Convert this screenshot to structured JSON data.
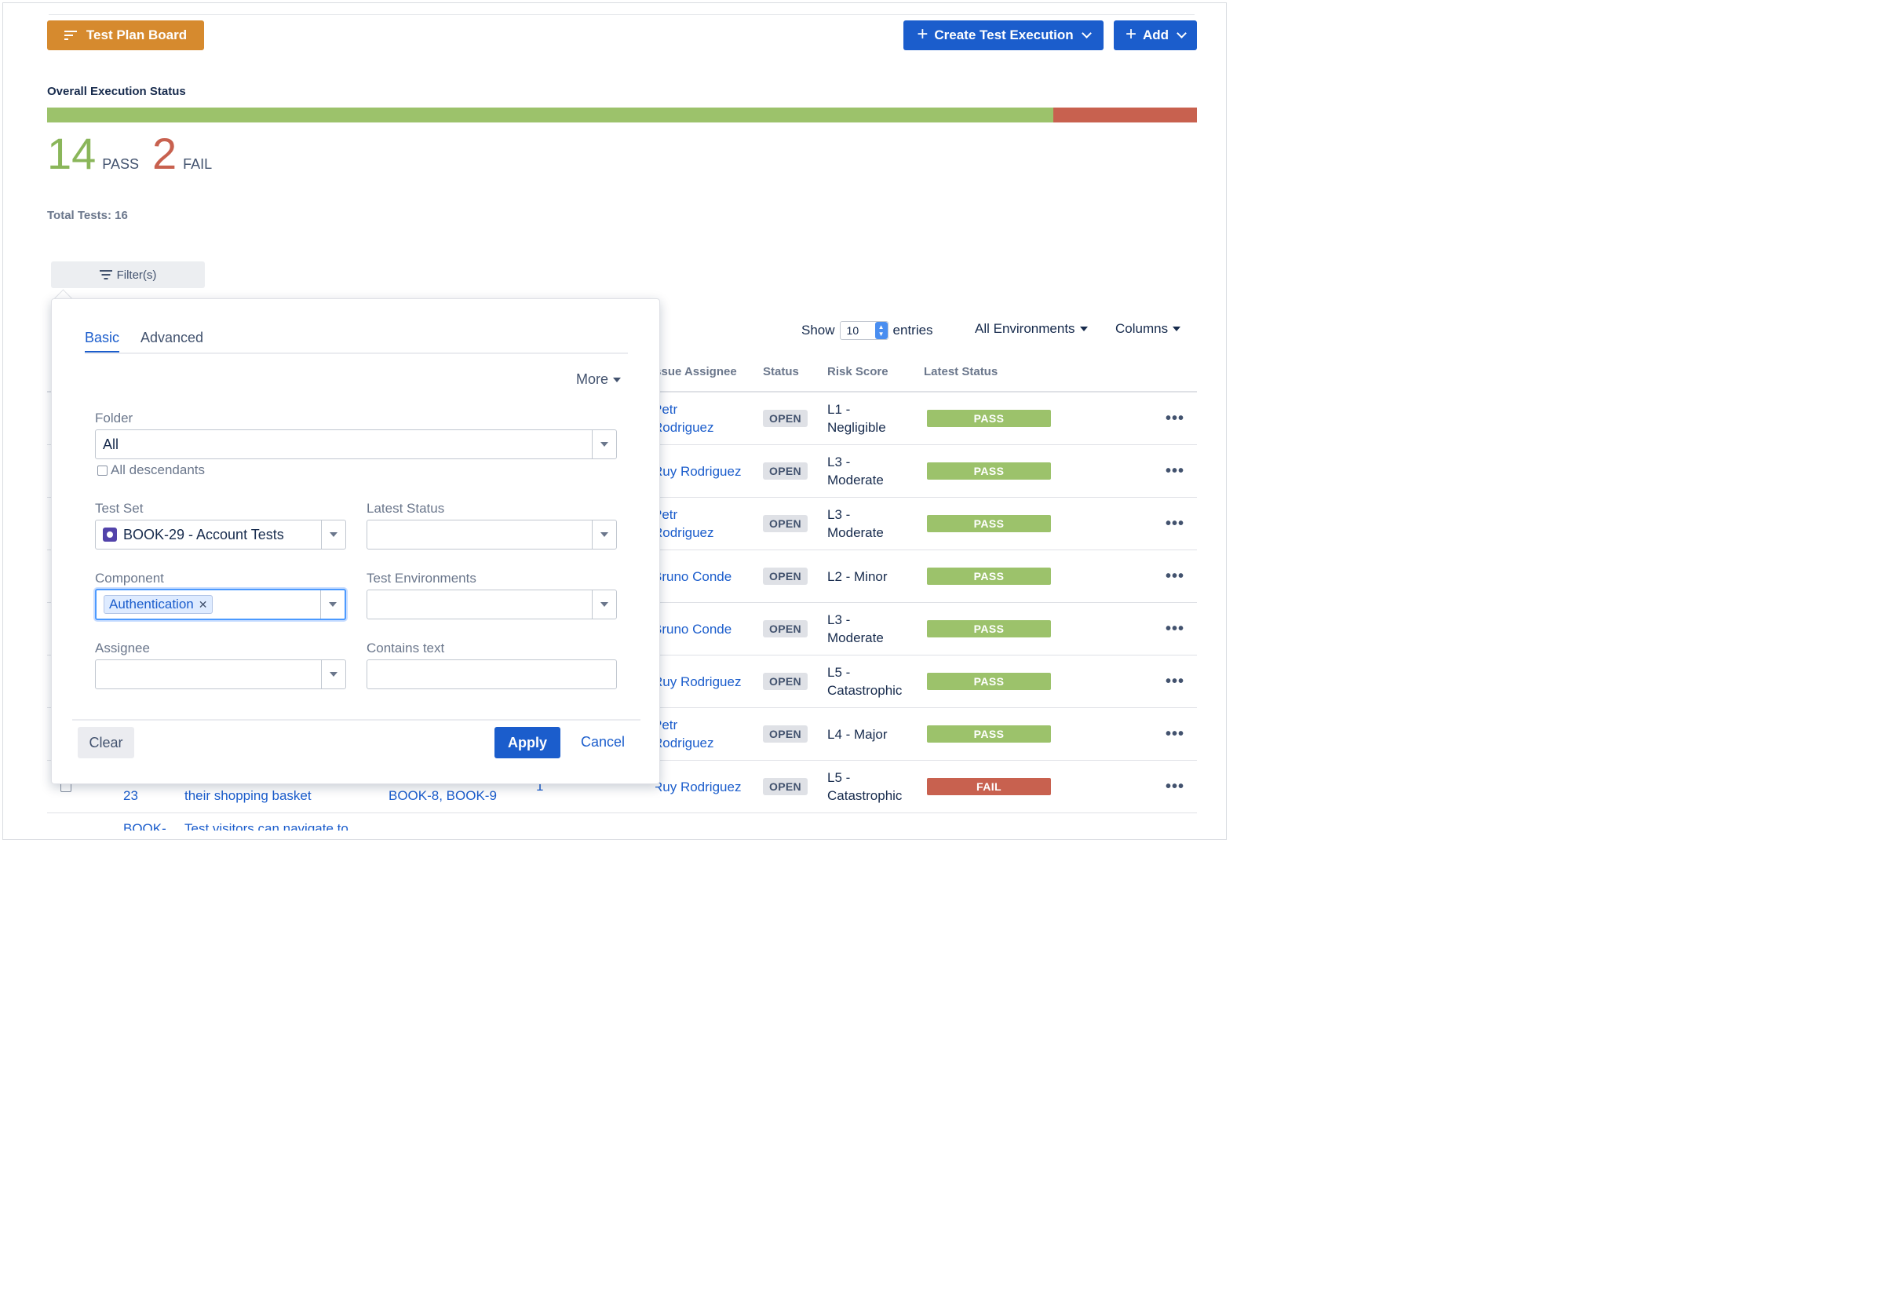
{
  "header": {
    "board_button": "Test Plan Board",
    "create_button": "Create Test Execution",
    "add_button": "Add"
  },
  "overall": {
    "title": "Overall Execution Status",
    "pass_count": "14",
    "pass_label": "PASS",
    "fail_count": "2",
    "fail_label": "FAIL",
    "pass_fraction": 0.875,
    "fail_fraction": 0.125,
    "total": "Total Tests: 16",
    "colors": {
      "pass": "#9cc26b",
      "fail": "#c8614f"
    }
  },
  "filters_button": "Filter(s)",
  "table_controls": {
    "show_label": "Show",
    "entries_value": "10",
    "entries_label": "entries",
    "environments": "All Environments",
    "columns": "Columns"
  },
  "table": {
    "headers": {
      "assignee": "Issue Assignee",
      "status": "Status",
      "risk": "Risk Score",
      "latest": "Latest Status"
    },
    "rows": [
      {
        "assignee_1": "Petr",
        "assignee_2": "Rodriguez",
        "status": "OPEN",
        "risk_1": "L1 -",
        "risk_2": "Negligible",
        "latest": "PASS"
      },
      {
        "assignee_1": "Ruy Rodriguez",
        "assignee_2": "",
        "status": "OPEN",
        "risk_1": "L3 -",
        "risk_2": "Moderate",
        "latest": "PASS"
      },
      {
        "assignee_1": "Petr",
        "assignee_2": "Rodriguez",
        "status": "OPEN",
        "risk_1": "L3 -",
        "risk_2": "Moderate",
        "latest": "PASS"
      },
      {
        "assignee_1": "Bruno Conde",
        "assignee_2": "",
        "status": "OPEN",
        "risk_1": "L2 - Minor",
        "risk_2": "",
        "latest": "PASS"
      },
      {
        "assignee_1": "Bruno Conde",
        "assignee_2": "",
        "status": "OPEN",
        "risk_1": "L3 -",
        "risk_2": "Moderate",
        "latest": "PASS"
      },
      {
        "assignee_1": "Ruy Rodriguez",
        "assignee_2": "",
        "status": "OPEN",
        "risk_1": "L5 -",
        "risk_2": "Catastrophic",
        "latest": "PASS"
      },
      {
        "assignee_1": "Petr",
        "assignee_2": "Rodriguez",
        "status": "OPEN",
        "risk_1": "L4 - Major",
        "risk_2": "",
        "latest": "PASS"
      },
      {
        "assignee_1": "Ruy Rodriguez",
        "assignee_2": "",
        "status": "OPEN",
        "risk_1": "L5 -",
        "risk_2": "Catastrophic",
        "latest": "FAIL"
      }
    ],
    "row8_partial": {
      "key": "23",
      "summary": "their shopping basket",
      "requirements": "BOOK-8, BOOK-9",
      "count": "1"
    },
    "row9_partial": {
      "key": "BOOK-",
      "summary": "Test visitors can navigate to"
    },
    "actions_glyph": "•••"
  },
  "filter_panel": {
    "tabs": {
      "basic": "Basic",
      "advanced": "Advanced"
    },
    "more": "More",
    "folder": {
      "label": "Folder",
      "value": "All"
    },
    "all_descendants": "All descendants",
    "test_set": {
      "label": "Test Set",
      "value": "BOOK-29 - Account Tests"
    },
    "latest_status": {
      "label": "Latest Status",
      "value": ""
    },
    "component": {
      "label": "Component",
      "tag": "Authentication"
    },
    "test_environments": {
      "label": "Test Environments",
      "value": ""
    },
    "assignee": {
      "label": "Assignee",
      "value": ""
    },
    "contains_text": {
      "label": "Contains text",
      "value": ""
    },
    "clear": "Clear",
    "apply": "Apply",
    "cancel": "Cancel"
  }
}
